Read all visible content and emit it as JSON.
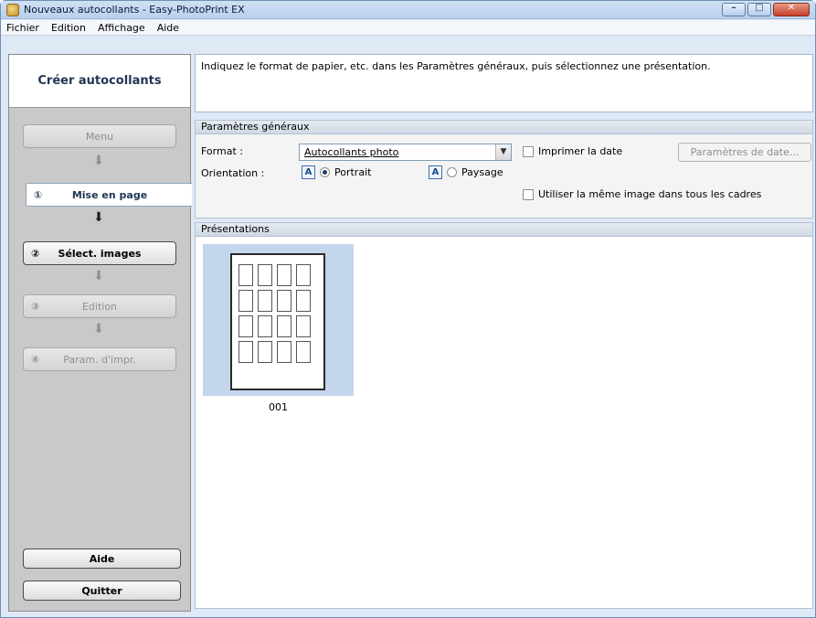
{
  "window": {
    "title": "Nouveaux autocollants - Easy-PhotoPrint EX",
    "minimize_glyph": "–",
    "maximize_glyph": "□",
    "close_glyph": "✕"
  },
  "menu": {
    "file": "Fichier",
    "edit": "Edition",
    "view": "Affichage",
    "help": "Aide"
  },
  "sidebar": {
    "header": "Créer autocollants",
    "steps": [
      {
        "num": "",
        "label": "Menu"
      },
      {
        "num": "①",
        "label": "Mise en page"
      },
      {
        "num": "②",
        "label": "Sélect. images"
      },
      {
        "num": "③",
        "label": "Edition"
      },
      {
        "num": "④",
        "label": "Param. d'impr."
      }
    ],
    "help_button": "Aide",
    "quit_button": "Quitter"
  },
  "instruction": "Indiquez le format de papier, etc. dans les Paramètres généraux, puis sélectionnez une présentation.",
  "general_settings": {
    "title": "Paramètres généraux",
    "format_label": "Format :",
    "format_value": "Autocollants photo",
    "orientation_label": "Orientation :",
    "portrait_label": "Portrait",
    "landscape_label": "Paysage",
    "orientation_icon": "A",
    "print_date_label": "Imprimer la date",
    "date_settings_button": "Paramètres de date...",
    "same_image_label": "Utiliser la même image dans tous les cadres"
  },
  "layouts": {
    "title": "Présentations",
    "items": [
      {
        "label": "001"
      }
    ]
  }
}
